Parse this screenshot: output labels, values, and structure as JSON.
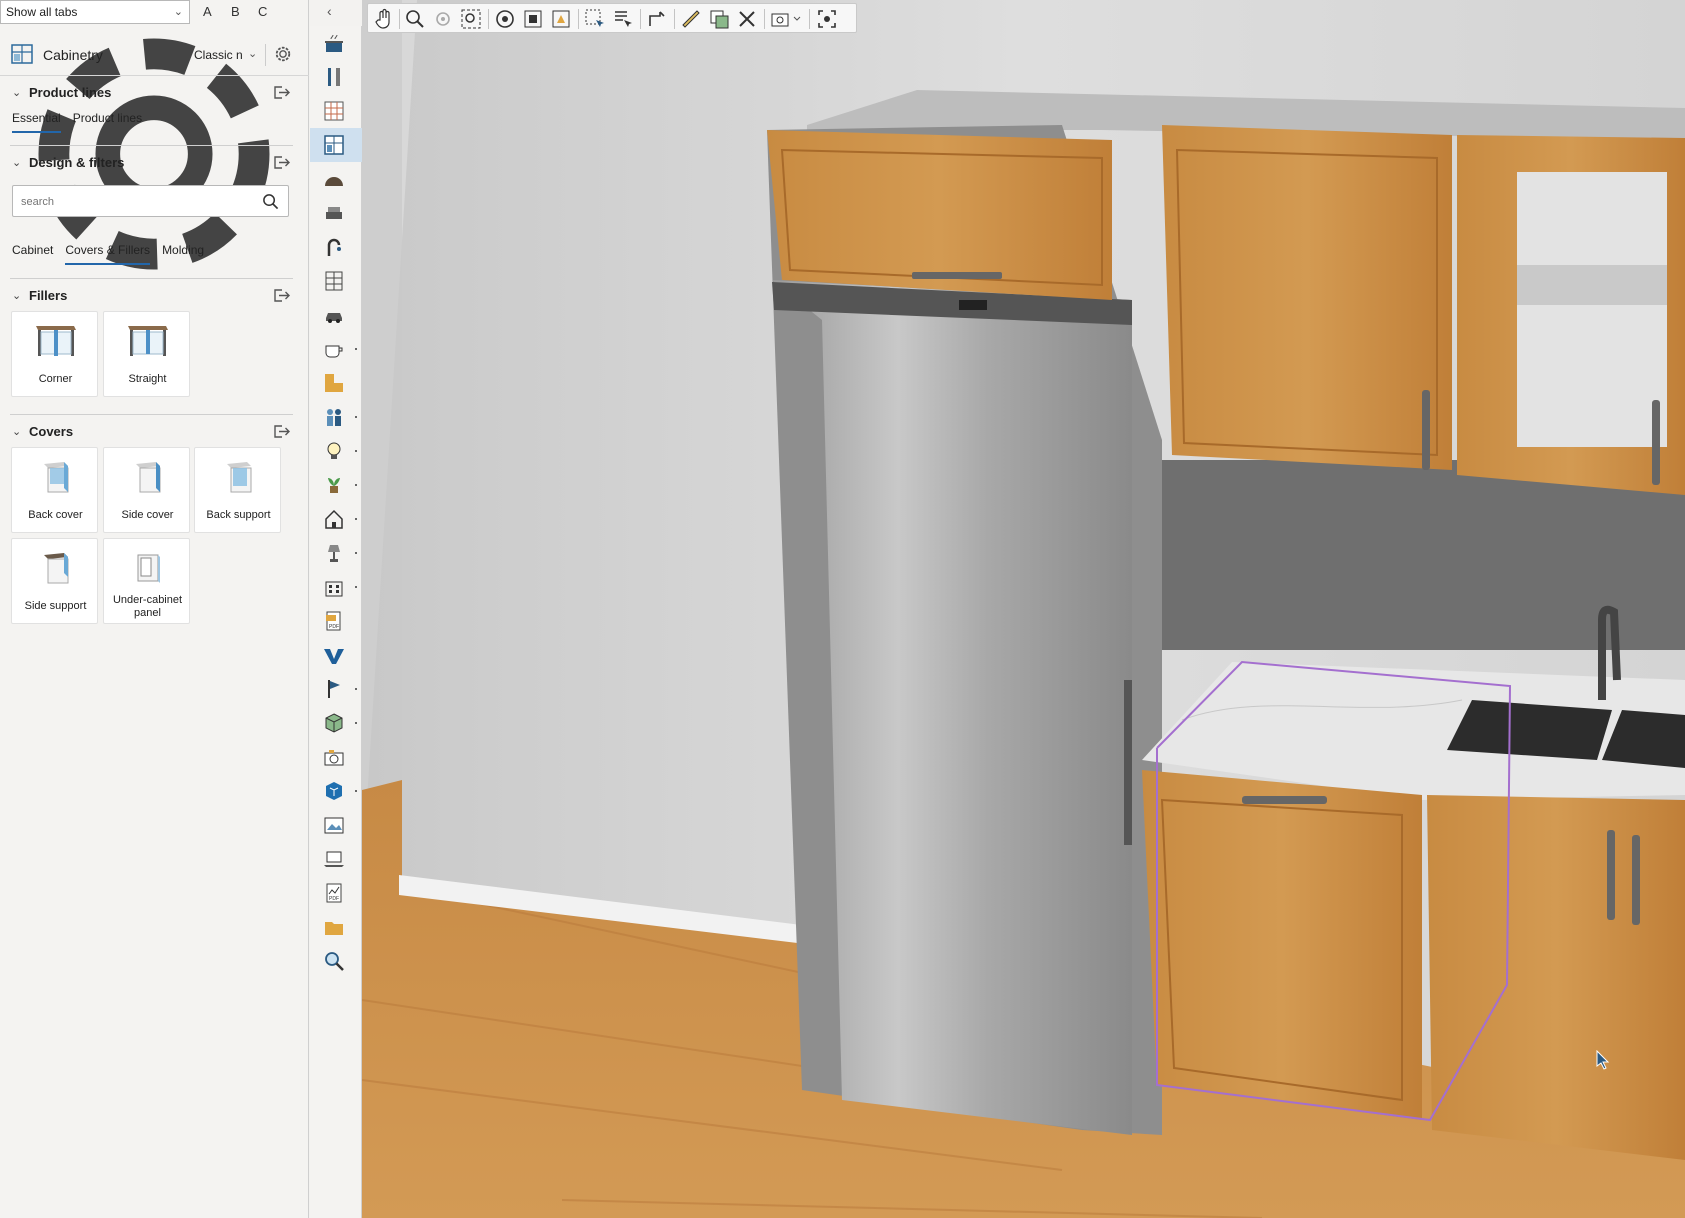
{
  "topbar": {
    "tabs_select": "Show all tabs",
    "letter_a": "A",
    "letter_b": "B",
    "letter_c": "C"
  },
  "library": {
    "title": "Cabinetry",
    "style": "Classic n"
  },
  "product_lines": {
    "title": "Product lines",
    "tabs": [
      "Essential",
      "Product lines"
    ]
  },
  "design_filters": {
    "title": "Design & filters",
    "search_placeholder": "search",
    "tabs": [
      "Cabinet",
      "Covers & Fillers",
      "Molding"
    ]
  },
  "fillers": {
    "title": "Fillers",
    "items": [
      "Corner",
      "Straight"
    ]
  },
  "covers": {
    "title": "Covers",
    "items": [
      "Back cover",
      "Side cover",
      "Back support",
      "Side support",
      "Under-cabinet panel"
    ]
  },
  "colors": {
    "accent": "#2266aa",
    "selection_outline": "#a46fcf",
    "active_tool_bg": "#cfe0ef",
    "wood": "#c8893f"
  },
  "vertical_tools": [
    "cooktop-icon",
    "utensils-icon",
    "tile-wall-icon",
    "cabinetry-icon",
    "arch-icon",
    "sofa-icon",
    "faucet-icon",
    "shelving-icon",
    "car-icon",
    "cup-icon",
    "l-shape-icon",
    "people-icon",
    "lightbulb-icon",
    "plant-icon",
    "house-icon",
    "lamp-icon",
    "building-icon",
    "pdf-export-icon",
    "v-logo-icon",
    "flag-icon",
    "cube-icon",
    "camera-icon",
    "sketchup-icon",
    "gallery-icon",
    "laptop-icon",
    "chart-pdf-icon",
    "folder-icon",
    "search-icon"
  ],
  "view_tools": [
    "pan-hand-icon",
    "zoom-in-icon",
    "zoom-region-icon",
    "zoom-fit-icon",
    "orbit-icon",
    "fit-all-icon",
    "fit-selection-icon",
    "select-area-icon",
    "select-list-icon",
    "dimension-icon",
    "measure-icon",
    "copy-view-icon",
    "clear-icon",
    "camera-settings-icon",
    "focus-icon"
  ]
}
